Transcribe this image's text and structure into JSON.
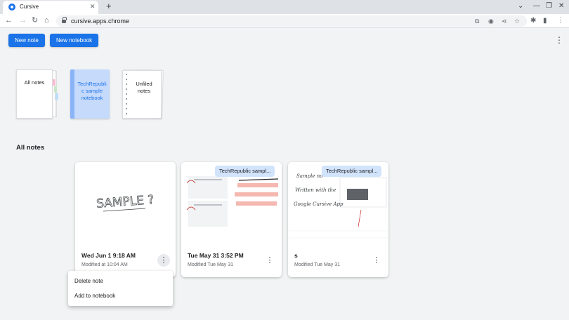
{
  "browser": {
    "tab_title": "Cursive",
    "url": "cursive.apps.chrome"
  },
  "toolbar": {
    "new_note_label": "New note",
    "new_notebook_label": "New notebook"
  },
  "notebooks": [
    {
      "label": "All notes"
    },
    {
      "label": "TechRepubli c sample notebook"
    },
    {
      "label": "Unfiled notes"
    }
  ],
  "section_title": "All notes",
  "notes": [
    {
      "date": "Wed Jun 1 9:18 AM",
      "modified": "Modified at 10:04 AM",
      "thumb_text": "SAMPLE ?",
      "chip": ""
    },
    {
      "date": "Tue May 31 3:52 PM",
      "modified": "Modified Tue May 31",
      "chip": "TechRepublic sampl..."
    },
    {
      "date": "s",
      "modified": "Modified Tue May 31",
      "chip": "TechRepublic sampl...",
      "thumb_lines": [
        "Sample no",
        "Written with the",
        "Google Cursive App"
      ]
    }
  ],
  "context_menu": {
    "items": [
      "Delete note",
      "Add to notebook"
    ]
  },
  "colors": {
    "accent": "#1a73e8",
    "chip": "#d2e3fc",
    "notebook_blue": "#c6dafc"
  }
}
